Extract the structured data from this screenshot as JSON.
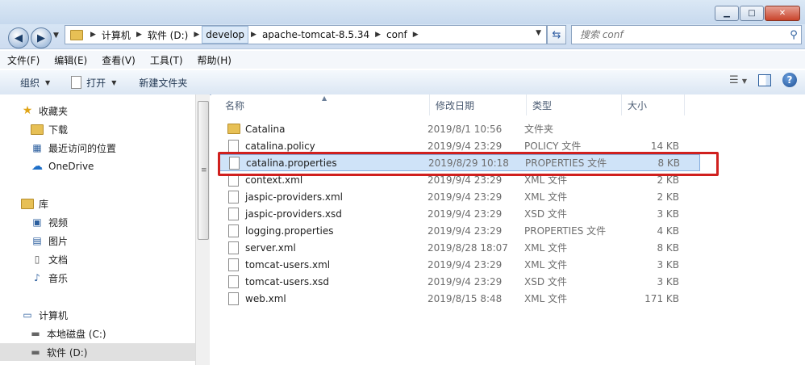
{
  "window": {
    "min": "▁",
    "max": "□",
    "close": "✕"
  },
  "address": {
    "crumbs": [
      "计算机",
      "软件 (D:)",
      "develop",
      "apache-tomcat-8.5.34",
      "conf"
    ]
  },
  "search": {
    "placeholder": "搜索 conf"
  },
  "menu": [
    "文件(F)",
    "编辑(E)",
    "查看(V)",
    "工具(T)",
    "帮助(H)"
  ],
  "toolbar": {
    "organize": "组织",
    "open": "打开",
    "new_folder": "新建文件夹"
  },
  "nav": {
    "favorites": {
      "title": "收藏夹",
      "items": [
        "下载",
        "最近访问的位置"
      ]
    },
    "onedrive": "OneDrive",
    "libraries": {
      "title": "库",
      "items": [
        "视频",
        "图片",
        "文档",
        "音乐"
      ]
    },
    "computer": {
      "title": "计算机",
      "items": [
        "本地磁盘 (C:)",
        "软件 (D:)"
      ]
    }
  },
  "columns": {
    "name": "名称",
    "date": "修改日期",
    "type": "类型",
    "size": "大小"
  },
  "files": [
    {
      "name": "Catalina",
      "date": "2019/8/1 10:56",
      "type": "文件夹",
      "size": ""
    },
    {
      "name": "catalina.policy",
      "date": "2019/9/4 23:29",
      "type": "POLICY 文件",
      "size": "14 KB"
    },
    {
      "name": "catalina.properties",
      "date": "2019/8/29 10:18",
      "type": "PROPERTIES 文件",
      "size": "8 KB"
    },
    {
      "name": "context.xml",
      "date": "2019/9/4 23:29",
      "type": "XML 文件",
      "size": "2 KB"
    },
    {
      "name": "jaspic-providers.xml",
      "date": "2019/9/4 23:29",
      "type": "XML 文件",
      "size": "2 KB"
    },
    {
      "name": "jaspic-providers.xsd",
      "date": "2019/9/4 23:29",
      "type": "XSD 文件",
      "size": "3 KB"
    },
    {
      "name": "logging.properties",
      "date": "2019/9/4 23:29",
      "type": "PROPERTIES 文件",
      "size": "4 KB"
    },
    {
      "name": "server.xml",
      "date": "2019/8/28 18:07",
      "type": "XML 文件",
      "size": "8 KB"
    },
    {
      "name": "tomcat-users.xml",
      "date": "2019/9/4 23:29",
      "type": "XML 文件",
      "size": "3 KB"
    },
    {
      "name": "tomcat-users.xsd",
      "date": "2019/9/4 23:29",
      "type": "XSD 文件",
      "size": "3 KB"
    },
    {
      "name": "web.xml",
      "date": "2019/8/15 8:48",
      "type": "XML 文件",
      "size": "171 KB"
    }
  ],
  "colors": {
    "highlight": "#d0201e",
    "selection": "#cfe3f8"
  }
}
